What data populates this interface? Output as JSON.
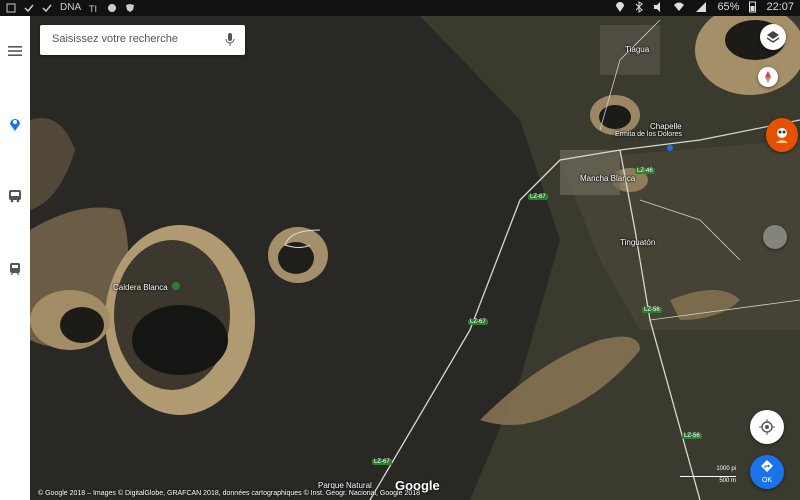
{
  "status": {
    "icons_left": [
      "image-icon",
      "check-icon",
      "check-icon",
      "dna-badge",
      "tripadvisor-icon",
      "vpn-icon",
      "shield-icon"
    ],
    "left_text": "DNA",
    "battery": "65%",
    "time": "22:07"
  },
  "search": {
    "placeholder": "Saisissez votre recherche"
  },
  "sidebar": {
    "icons": [
      "menu-icon",
      "explore-icon",
      "transit-bus-icon",
      "train-icon"
    ]
  },
  "map": {
    "places": [
      {
        "name": "Caldera Blanca"
      },
      {
        "name": "Tiagua"
      },
      {
        "name": "Chapelle"
      },
      {
        "name": "Ermita de los Dolores"
      },
      {
        "name": "Mancha Blanca"
      },
      {
        "name": "Tinguatón"
      },
      {
        "name": "Parque Natural"
      }
    ],
    "roads": [
      "LZ-67",
      "LZ-67",
      "LZ-56",
      "LZ-56",
      "LZ-46",
      "LZ-67"
    ]
  },
  "controls": {
    "layers": "layers-icon",
    "compass": "compass-icon",
    "locate": "my-location-icon",
    "directions_label": "OK"
  },
  "footer": {
    "attribution": "© Google 2018 – Images © DigitalGlobe, GRAFCAN 2018, données cartographiques © Inst. Geogr. Nacional, Google 2018",
    "logo": "Google",
    "scale_top": "1000 pi",
    "scale_bottom": "500 m"
  }
}
